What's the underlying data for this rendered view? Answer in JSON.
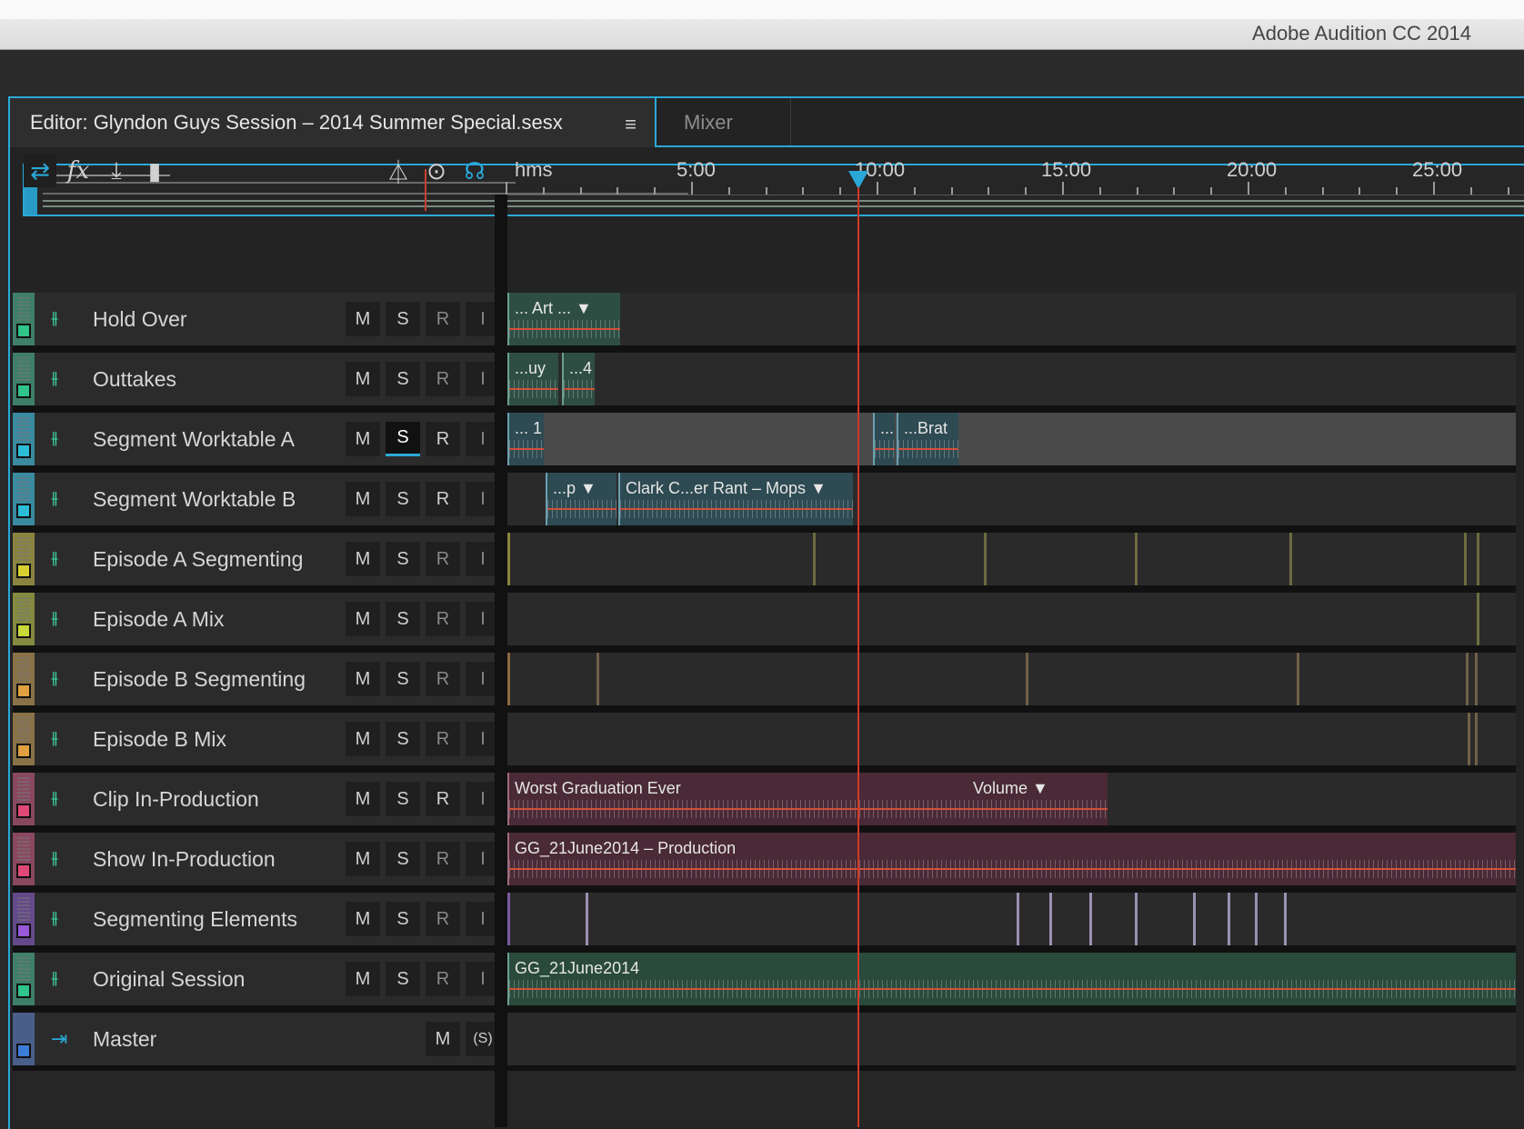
{
  "window": {
    "app_title": "Adobe Audition CC 2014"
  },
  "tabs": {
    "editor_label": "Editor: Glyndon Guys Session – 2014 Summer Special.sesx",
    "menu_glyph": "≡",
    "mixer_label": "Mixer"
  },
  "toolbar": {
    "icons": [
      "io-arrows-icon",
      "fx-icon",
      "sends-icon",
      "eq-icon",
      "metronome-icon",
      "snap-icon",
      "headphones-icon"
    ],
    "fx_label": "fx"
  },
  "ruler": {
    "labels": [
      "hms",
      "5:00",
      "10:00",
      "15:00",
      "20:00",
      "25:00"
    ]
  },
  "button_labels": {
    "m": "M",
    "s": "S",
    "r": "R",
    "i": "I",
    "master_s": "(S)"
  },
  "colors": {
    "accent": "#2aa8d8",
    "playhead": "#d03a28",
    "track_icon": "#3fd8a0"
  },
  "tracks": [
    {
      "name": "Hold Over",
      "color": "#2ec48a",
      "clips": [
        {
          "label": "... Art ...   ▼"
        }
      ]
    },
    {
      "name": "Outtakes",
      "color": "#2ec48a",
      "clips": [
        {
          "label": "...uy"
        },
        {
          "label": "...4"
        }
      ]
    },
    {
      "name": "Segment Worktable A",
      "color": "#2bbcd8",
      "clips": [
        {
          "label": "... 1"
        },
        {
          "label": "..."
        },
        {
          "label": "...Brat"
        }
      ]
    },
    {
      "name": "Segment Worktable B",
      "color": "#2bbcd8",
      "clips": [
        {
          "label": "...p   ▼"
        },
        {
          "label": "Clark C...er Rant – Mops   ▼"
        }
      ]
    },
    {
      "name": "Episode A Segmenting",
      "color": "#d8d030",
      "clips": []
    },
    {
      "name": "Episode A Mix",
      "color": "#c8d838",
      "clips": []
    },
    {
      "name": "Episode B Segmenting",
      "color": "#e0a040",
      "clips": []
    },
    {
      "name": "Episode B Mix",
      "color": "#e0a040",
      "clips": []
    },
    {
      "name": "Clip In-Production",
      "color": "#e04878",
      "clips": [
        {
          "label": "Worst Graduation Ever"
        },
        {
          "label": "Volume   ▼"
        }
      ]
    },
    {
      "name": "Show In-Production",
      "color": "#e04878",
      "clips": [
        {
          "label": "GG_21June2014 – Production"
        }
      ]
    },
    {
      "name": "Segmenting Elements",
      "color": "#9858d8",
      "clips": []
    },
    {
      "name": "Original Session",
      "color": "#2ec48a",
      "clips": [
        {
          "label": "GG_21June2014"
        }
      ]
    },
    {
      "name": "Master",
      "color": "#3a7cd8",
      "clips": []
    }
  ]
}
